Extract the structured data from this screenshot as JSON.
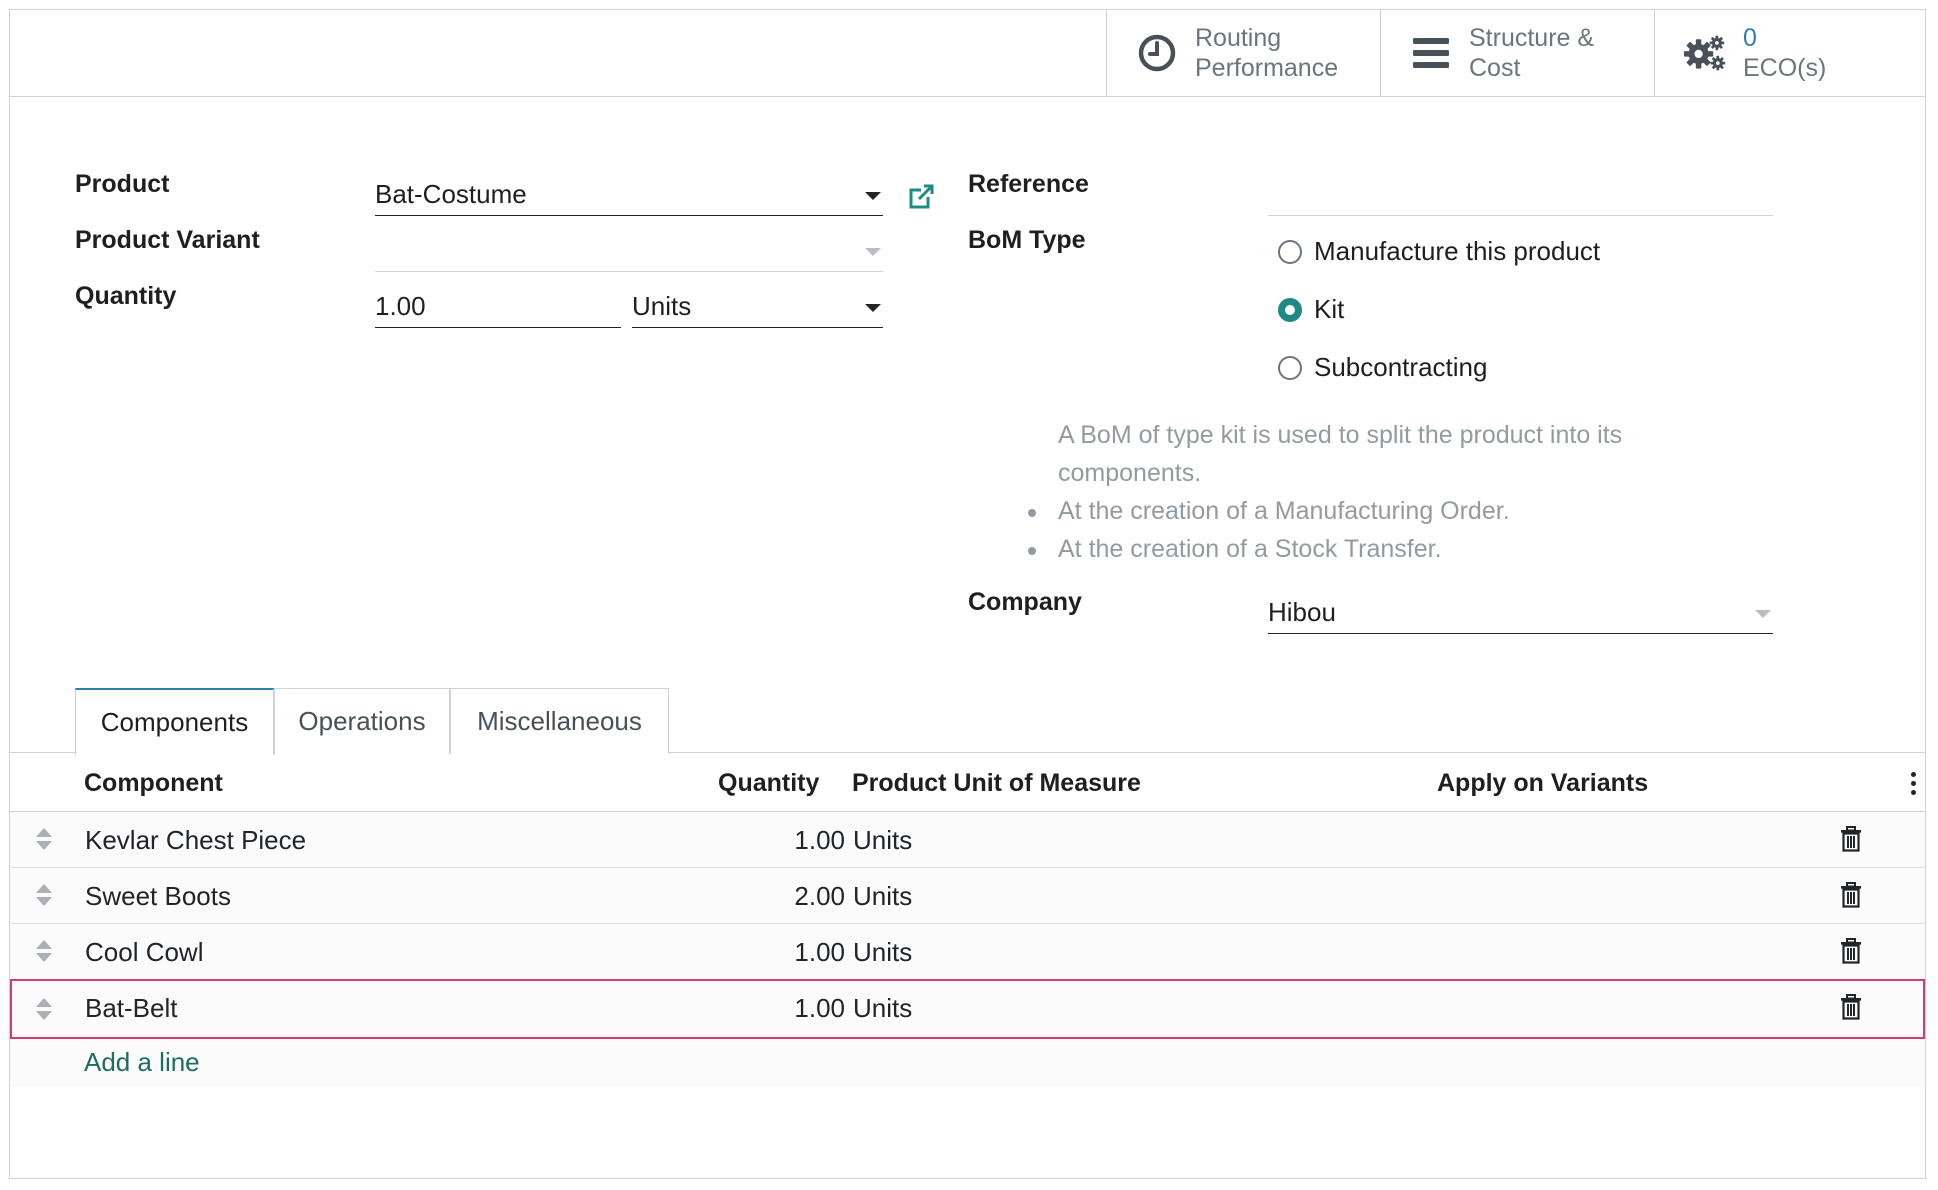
{
  "smart_buttons": {
    "routing": {
      "line1": "Routing",
      "line2": "Performance"
    },
    "structure": {
      "line1": "Structure &",
      "line2": "Cost"
    },
    "eco": {
      "count": "0",
      "label": "ECO(s)"
    }
  },
  "form": {
    "product": {
      "label": "Product",
      "value": "Bat-Costume"
    },
    "product_variant": {
      "label": "Product Variant",
      "value": ""
    },
    "quantity": {
      "label": "Quantity",
      "value": "1.00",
      "uom": "Units"
    },
    "reference": {
      "label": "Reference",
      "value": ""
    },
    "bom_type": {
      "label": "BoM Type",
      "options": [
        "Manufacture this product",
        "Kit",
        "Subcontracting"
      ],
      "selected": "Kit"
    },
    "help": {
      "line1": "A BoM of type kit is used to split the product into its",
      "line2": "components.",
      "bullets": [
        "At the creation of a Manufacturing Order.",
        "At the creation of a Stock Transfer."
      ]
    },
    "company": {
      "label": "Company",
      "value": "Hibou"
    }
  },
  "tabs": [
    "Components",
    "Operations",
    "Miscellaneous"
  ],
  "active_tab": "Components",
  "table": {
    "headers": {
      "component": "Component",
      "quantity": "Quantity",
      "uom": "Product Unit of Measure",
      "variants": "Apply on Variants"
    },
    "rows": [
      {
        "component": "Kevlar Chest Piece",
        "quantity": "1.00",
        "uom": "Units"
      },
      {
        "component": "Sweet Boots",
        "quantity": "2.00",
        "uom": "Units"
      },
      {
        "component": "Cool Cowl",
        "quantity": "1.00",
        "uom": "Units"
      },
      {
        "component": "Bat-Belt",
        "quantity": "1.00",
        "uom": "Units"
      }
    ],
    "add_line": "Add a line"
  },
  "colors": {
    "accent": "#1f8a83",
    "link": "#1f6c66",
    "highlight": "#d33d6a",
    "count": "#2f7fa8"
  }
}
